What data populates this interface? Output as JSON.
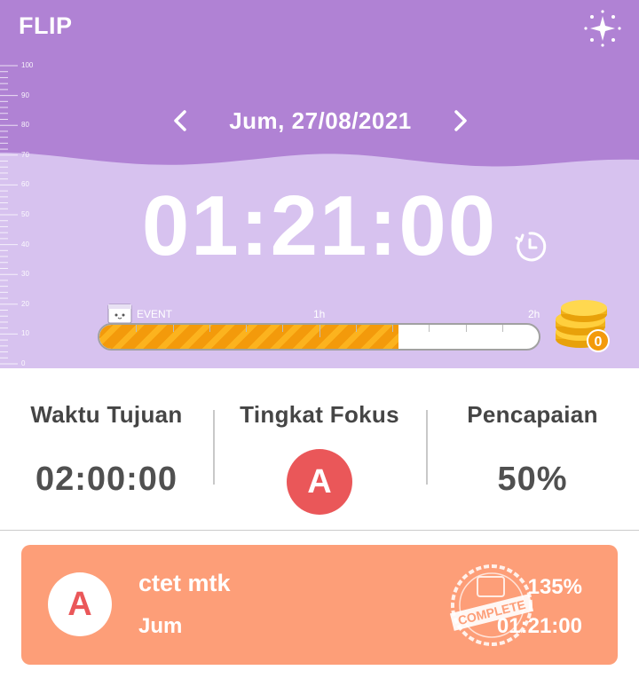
{
  "app": {
    "title": "FLIP"
  },
  "date_nav": {
    "date": "Jum, 27/08/2021",
    "prev_icon": "chevron-left-icon",
    "next_icon": "chevron-right-icon"
  },
  "ruler": {
    "labels": [
      "100",
      "90",
      "80",
      "70",
      "60",
      "50",
      "40",
      "30",
      "20",
      "10",
      "0"
    ]
  },
  "timer": {
    "value": "01:21:00",
    "icon": "timer-clock-icon"
  },
  "progress": {
    "event_label": "EVENT",
    "mark_1h": "1h",
    "mark_2h": "2h",
    "fraction": 0.68,
    "coin_count": "0"
  },
  "stats": {
    "target_label": "Waktu Tujuan",
    "target_value": "02:00:00",
    "focus_label": "Tingkat Fokus",
    "focus_grade": "A",
    "achievement_label": "Pencapaian",
    "achievement_value": "50%"
  },
  "session": {
    "grade": "A",
    "title": "ctet mtk",
    "day": "Jum",
    "stamp_text": "COMPLETE",
    "percent": "135%",
    "time": "01:21:00"
  },
  "colors": {
    "header_dark": "#b082d4",
    "header_light": "#d7c2ef",
    "accent_red": "#ea5759",
    "card_orange": "#fd9e78",
    "progress_orange": "#f39a0b"
  }
}
